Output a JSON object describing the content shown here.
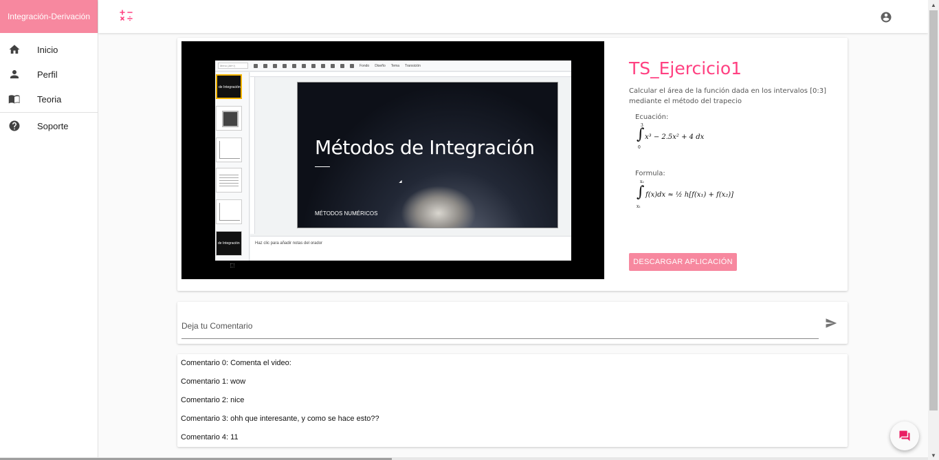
{
  "app": {
    "brand": "Integración-Derivación"
  },
  "sidebar": {
    "items": [
      {
        "label": "Inicio",
        "icon": "home-icon"
      },
      {
        "label": "Perfil",
        "icon": "person-icon"
      },
      {
        "label": "Teoria",
        "icon": "book-icon"
      },
      {
        "label": "Soporte",
        "icon": "help-icon"
      }
    ]
  },
  "topbar": {
    "calc_icon": "calculator-icon",
    "account_icon": "account-circle-icon"
  },
  "video": {
    "toolbar_search": "Menú (Alt+/)",
    "toolbar_items": [
      "Fondo",
      "Diseño",
      "Tema",
      "Transición"
    ],
    "thumb_text_1": "de Integración",
    "thumb_text_2": "de Integración",
    "slide_title": "Métodos de Integración",
    "slide_subtitle": "MÉTODOS NUMÉRICOS",
    "notes_placeholder": "Haz clic para añadir notas del orador"
  },
  "exercise": {
    "title": "TS_Ejercicio1",
    "description": "Calcular el área de la función dada en los intervalos [0:3] mediante el método del trapecio",
    "equation_label": "Ecuación:",
    "equation": "x³ − 2.5x² + 4 dx",
    "equation_upper": "3",
    "equation_lower": "0",
    "formula_label": "Formula:",
    "formula": "f(x)dx ≈ ½ h[f(x₁) + f(x₂)]",
    "formula_upper": "x₂",
    "formula_lower": "x₁",
    "download_label": "DESCARGAR APLICACIÓN"
  },
  "comment_box": {
    "placeholder": "Deja tu Comentario",
    "send_icon": "send-icon"
  },
  "comments": [
    "Comentario 0: Comenta el video:",
    "Comentario 1: wow",
    "Comentario 2: nice",
    "Comentario 3: ohh que interesante, y como se hace esto??",
    "Comentario 4: 11"
  ],
  "colors": {
    "brand": "#f7889f",
    "accent": "#ff4081"
  }
}
